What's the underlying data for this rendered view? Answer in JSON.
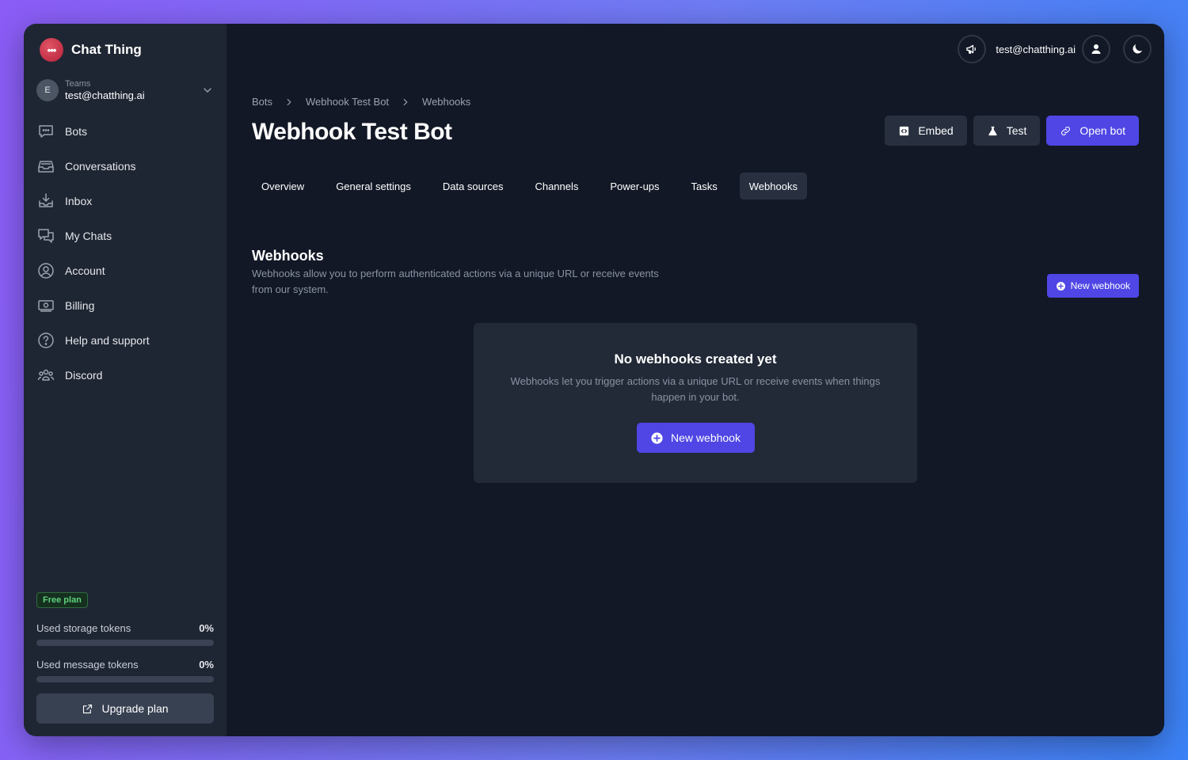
{
  "app": {
    "name": "Chat Thing",
    "logo_glyph": "•••"
  },
  "team": {
    "avatar_initial": "E",
    "label": "Teams",
    "email": "test@chatthing.ai"
  },
  "sidebar": {
    "items": [
      {
        "label": "Bots",
        "icon": "chat-bubble-icon"
      },
      {
        "label": "Conversations",
        "icon": "inbox-stack-icon"
      },
      {
        "label": "Inbox",
        "icon": "inbox-download-icon"
      },
      {
        "label": "My Chats",
        "icon": "chat-bubbles-icon"
      },
      {
        "label": "Account",
        "icon": "user-circle-icon"
      },
      {
        "label": "Billing",
        "icon": "banknote-icon"
      },
      {
        "label": "Help and support",
        "icon": "question-circle-icon"
      },
      {
        "label": "Discord",
        "icon": "users-group-icon"
      }
    ],
    "plan": "Free plan",
    "usage": [
      {
        "label": "Used storage tokens",
        "percent_text": "0%",
        "value": 0
      },
      {
        "label": "Used message tokens",
        "percent_text": "0%",
        "value": 0
      }
    ],
    "upgrade_label": "Upgrade plan"
  },
  "topbar": {
    "email": "test@chatthing.ai"
  },
  "breadcrumb": [
    "Bots",
    "Webhook Test Bot",
    "Webhooks"
  ],
  "page": {
    "title": "Webhook Test Bot"
  },
  "actions": {
    "embed": "Embed",
    "test": "Test",
    "open_bot": "Open bot"
  },
  "tabs": [
    {
      "label": "Overview",
      "active": false
    },
    {
      "label": "General settings",
      "active": false
    },
    {
      "label": "Data sources",
      "active": false
    },
    {
      "label": "Channels",
      "active": false
    },
    {
      "label": "Power-ups",
      "active": false
    },
    {
      "label": "Tasks",
      "active": false
    },
    {
      "label": "Webhooks",
      "active": true
    }
  ],
  "webhooks": {
    "title": "Webhooks",
    "description": "Webhooks allow you to perform authenticated actions via a unique URL or receive events from our system.",
    "new_button": "New webhook",
    "empty_title": "No webhooks created yet",
    "empty_description": "Webhooks let you trigger actions via a unique URL or receive events when things happen in your bot.",
    "empty_button": "New webhook"
  },
  "colors": {
    "accent": "#4f46e5",
    "background": "#121826",
    "sidebar": "#1f2633"
  }
}
